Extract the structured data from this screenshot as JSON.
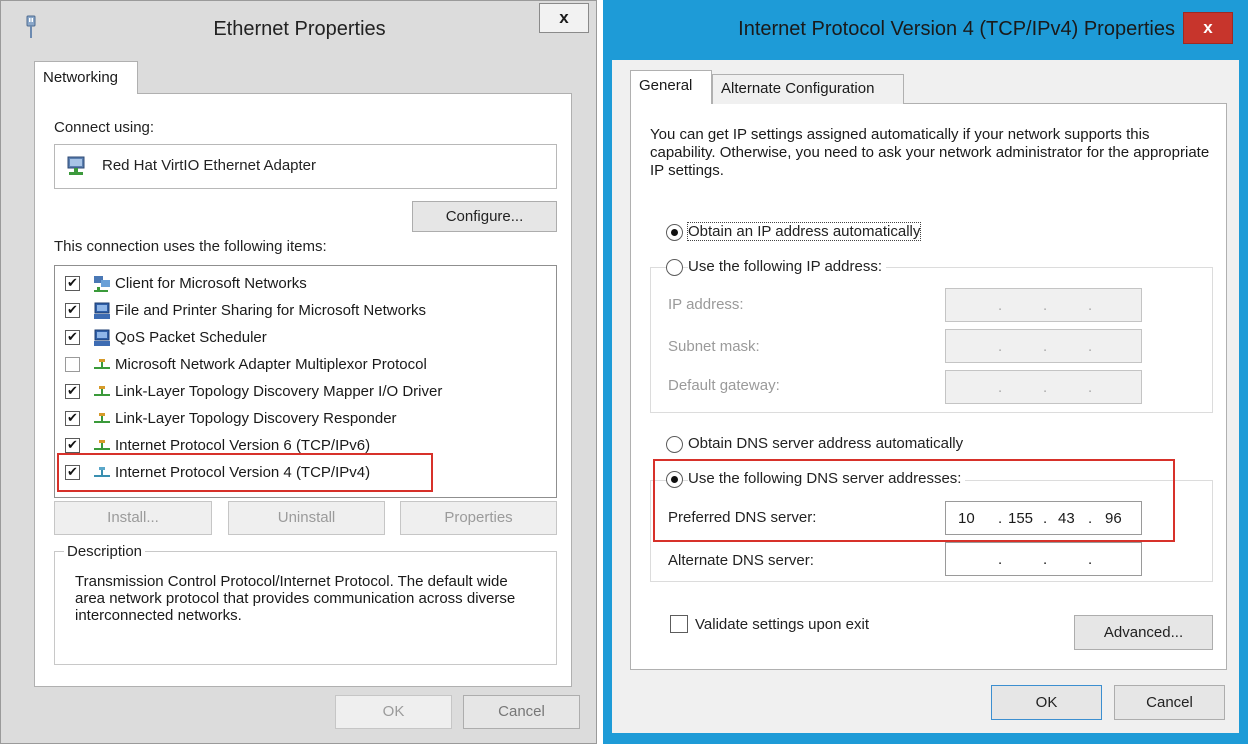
{
  "ethernet_dialog": {
    "title": "Ethernet Properties",
    "close_label": "x",
    "tab_networking": "Networking",
    "connect_using_label": "Connect using:",
    "adapter_name": "Red Hat VirtIO Ethernet Adapter",
    "configure_label": "Configure...",
    "items_heading": "This connection uses the following items:",
    "items": [
      {
        "label": "Client for Microsoft Networks",
        "checked": true,
        "icon": "network-client-icon"
      },
      {
        "label": "File and Printer Sharing for Microsoft Networks",
        "checked": true,
        "icon": "computer-service-icon"
      },
      {
        "label": "QoS Packet Scheduler",
        "checked": true,
        "icon": "computer-service-icon"
      },
      {
        "label": "Microsoft Network Adapter Multiplexor Protocol",
        "checked": false,
        "icon": "protocol-icon"
      },
      {
        "label": "Link-Layer Topology Discovery Mapper I/O Driver",
        "checked": true,
        "icon": "protocol-icon"
      },
      {
        "label": "Link-Layer Topology Discovery Responder",
        "checked": true,
        "icon": "protocol-icon"
      },
      {
        "label": "Internet Protocol Version 6 (TCP/IPv6)",
        "checked": true,
        "icon": "protocol-icon"
      },
      {
        "label": "Internet Protocol Version 4 (TCP/IPv4)",
        "checked": true,
        "icon": "protocol-icon"
      }
    ],
    "install_label": "Install...",
    "uninstall_label": "Uninstall",
    "properties_label": "Properties",
    "description_heading": "Description",
    "description_text": "Transmission Control Protocol/Internet Protocol. The default wide area network protocol that provides communication across diverse interconnected networks.",
    "ok_label": "OK",
    "cancel_label": "Cancel",
    "check_mark": "✔"
  },
  "ipv4_dialog": {
    "title": "Internet Protocol Version 4 (TCP/IPv4) Properties",
    "close_label": "x",
    "tab_general": "General",
    "tab_alternate": "Alternate Configuration",
    "intro_text": "You can get IP settings assigned automatically if your network supports this capability. Otherwise, you need to ask your network administrator for the appropriate IP settings.",
    "obtain_ip_auto": "Obtain an IP address automatically",
    "use_following_ip": "Use the following IP address:",
    "ip_address_label": "IP address:",
    "subnet_mask_label": "Subnet mask:",
    "default_gateway_label": "Default gateway:",
    "obtain_dns_auto": "Obtain DNS server address automatically",
    "use_following_dns": "Use the following DNS server addresses:",
    "preferred_dns_label": "Preferred DNS server:",
    "preferred_dns_octets": [
      "10",
      "155",
      "43",
      "96"
    ],
    "alternate_dns_label": "Alternate DNS server:",
    "validate_label": "Validate settings upon exit",
    "advanced_label": "Advanced...",
    "ok_label": "OK",
    "cancel_label": "Cancel",
    "dot": "."
  },
  "colors": {
    "accent_blue": "#1e9bd7",
    "close_red": "#c7352c",
    "highlight_red": "#d7312a"
  }
}
